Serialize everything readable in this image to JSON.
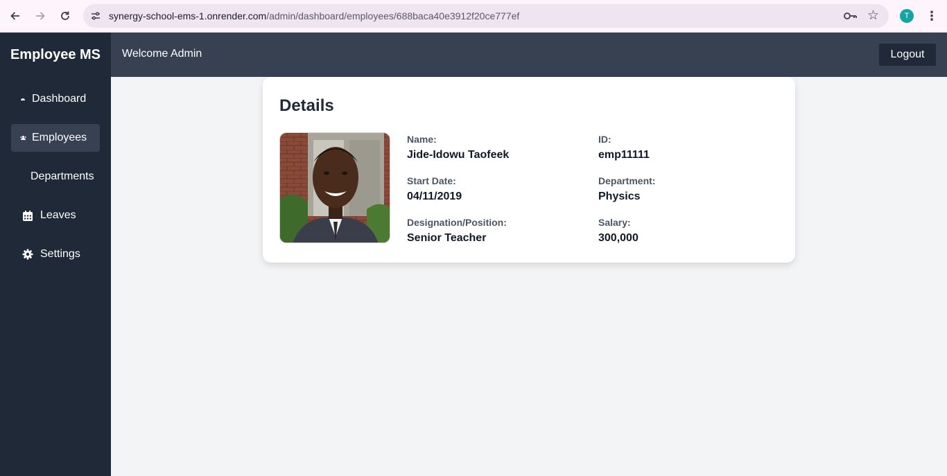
{
  "browser": {
    "url_host": "synergy-school-ems-1.onrender.com",
    "url_path": "/admin/dashboard/employees/688baca40e3912f20ce777ef",
    "profile_initial": "T"
  },
  "sidebar": {
    "brand": "Employee MS",
    "items": [
      {
        "label": "Dashboard",
        "icon": "dashboard-icon"
      },
      {
        "label": "Employees",
        "icon": "users-icon",
        "active": true
      },
      {
        "label": "Departments",
        "icon": ""
      },
      {
        "label": "Leaves",
        "icon": "calendar-icon"
      },
      {
        "label": "Settings",
        "icon": "gear-icon"
      }
    ]
  },
  "header": {
    "welcome": "Welcome Admin",
    "logout_label": "Logout"
  },
  "details": {
    "title": "Details",
    "fields": {
      "name": {
        "label": "Name:",
        "value": "Jide-Idowu Taofeek"
      },
      "id": {
        "label": "ID:",
        "value": "emp11111"
      },
      "start_date": {
        "label": "Start Date:",
        "value": "04/11/2019"
      },
      "department": {
        "label": "Department:",
        "value": "Physics"
      },
      "designation": {
        "label": "Designation/Position:",
        "value": "Senior Teacher"
      },
      "salary": {
        "label": "Salary:",
        "value": "300,000"
      }
    }
  }
}
